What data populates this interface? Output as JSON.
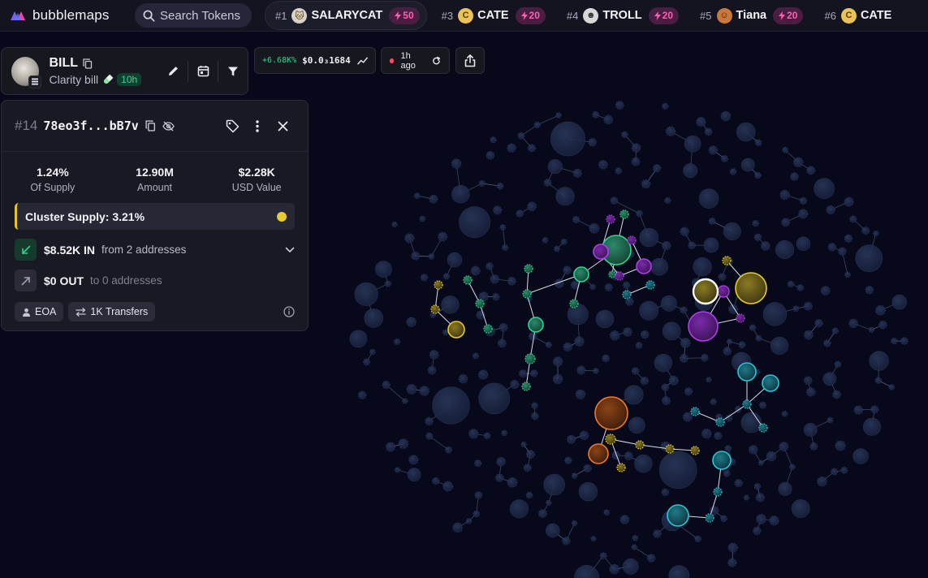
{
  "app": {
    "name": "bubblemaps",
    "brand_color": "#6b5cff"
  },
  "search": {
    "placeholder": "Search Tokens",
    "icon": "search-icon"
  },
  "trending": [
    {
      "rank": "#1",
      "name": "SALARYCAT",
      "boost": "50",
      "avatar_color": "#d9d2c8",
      "active": true
    },
    {
      "rank": "#3",
      "name": "CATE",
      "boost": "20",
      "avatar_color": "#e9c25a",
      "active": false
    },
    {
      "rank": "#4",
      "name": "TROLL",
      "boost": "20",
      "avatar_color": "#d8d8d8",
      "active": false
    },
    {
      "rank": "#5",
      "name": "Tiana",
      "boost": "20",
      "avatar_color": "#c97a3a",
      "active": false
    },
    {
      "rank": "#6",
      "name": "CATE",
      "boost": "",
      "avatar_color": "#e9c25a",
      "active": false
    }
  ],
  "token": {
    "symbol": "BILL",
    "name": "Clarity bill",
    "age": "10h",
    "chain_icon": "solana-icon"
  },
  "price": {
    "change": "+6.68K%",
    "value": "$0.0₃1684"
  },
  "timeframe": {
    "label": "1h ago"
  },
  "wallet": {
    "rank": "#14",
    "address": "78eo3f...bB7v",
    "stats": [
      {
        "value": "1.24%",
        "label": "Of Supply"
      },
      {
        "value": "12.90M",
        "label": "Amount"
      },
      {
        "value": "$2.28K",
        "label": "USD Value"
      }
    ],
    "cluster": {
      "label": "Cluster Supply: 3.21%",
      "color": "#e8cb2c"
    },
    "inflow": {
      "amount": "$8.52K IN",
      "sub": "from 2 addresses"
    },
    "outflow": {
      "amount": "$0 OUT",
      "sub": "to 0 addresses"
    },
    "tags": [
      {
        "label": "EOA",
        "icon": "user-icon"
      },
      {
        "label": "1K Transfers",
        "icon": "transfer-icon"
      }
    ]
  },
  "colors": {
    "green": "#2fd68f",
    "purple": "#b43cf0",
    "yellow": "#e8cb2c",
    "orange": "#f07a2a",
    "cyan": "#2bc6d8",
    "neutral_bubble": "#1f2a48"
  }
}
